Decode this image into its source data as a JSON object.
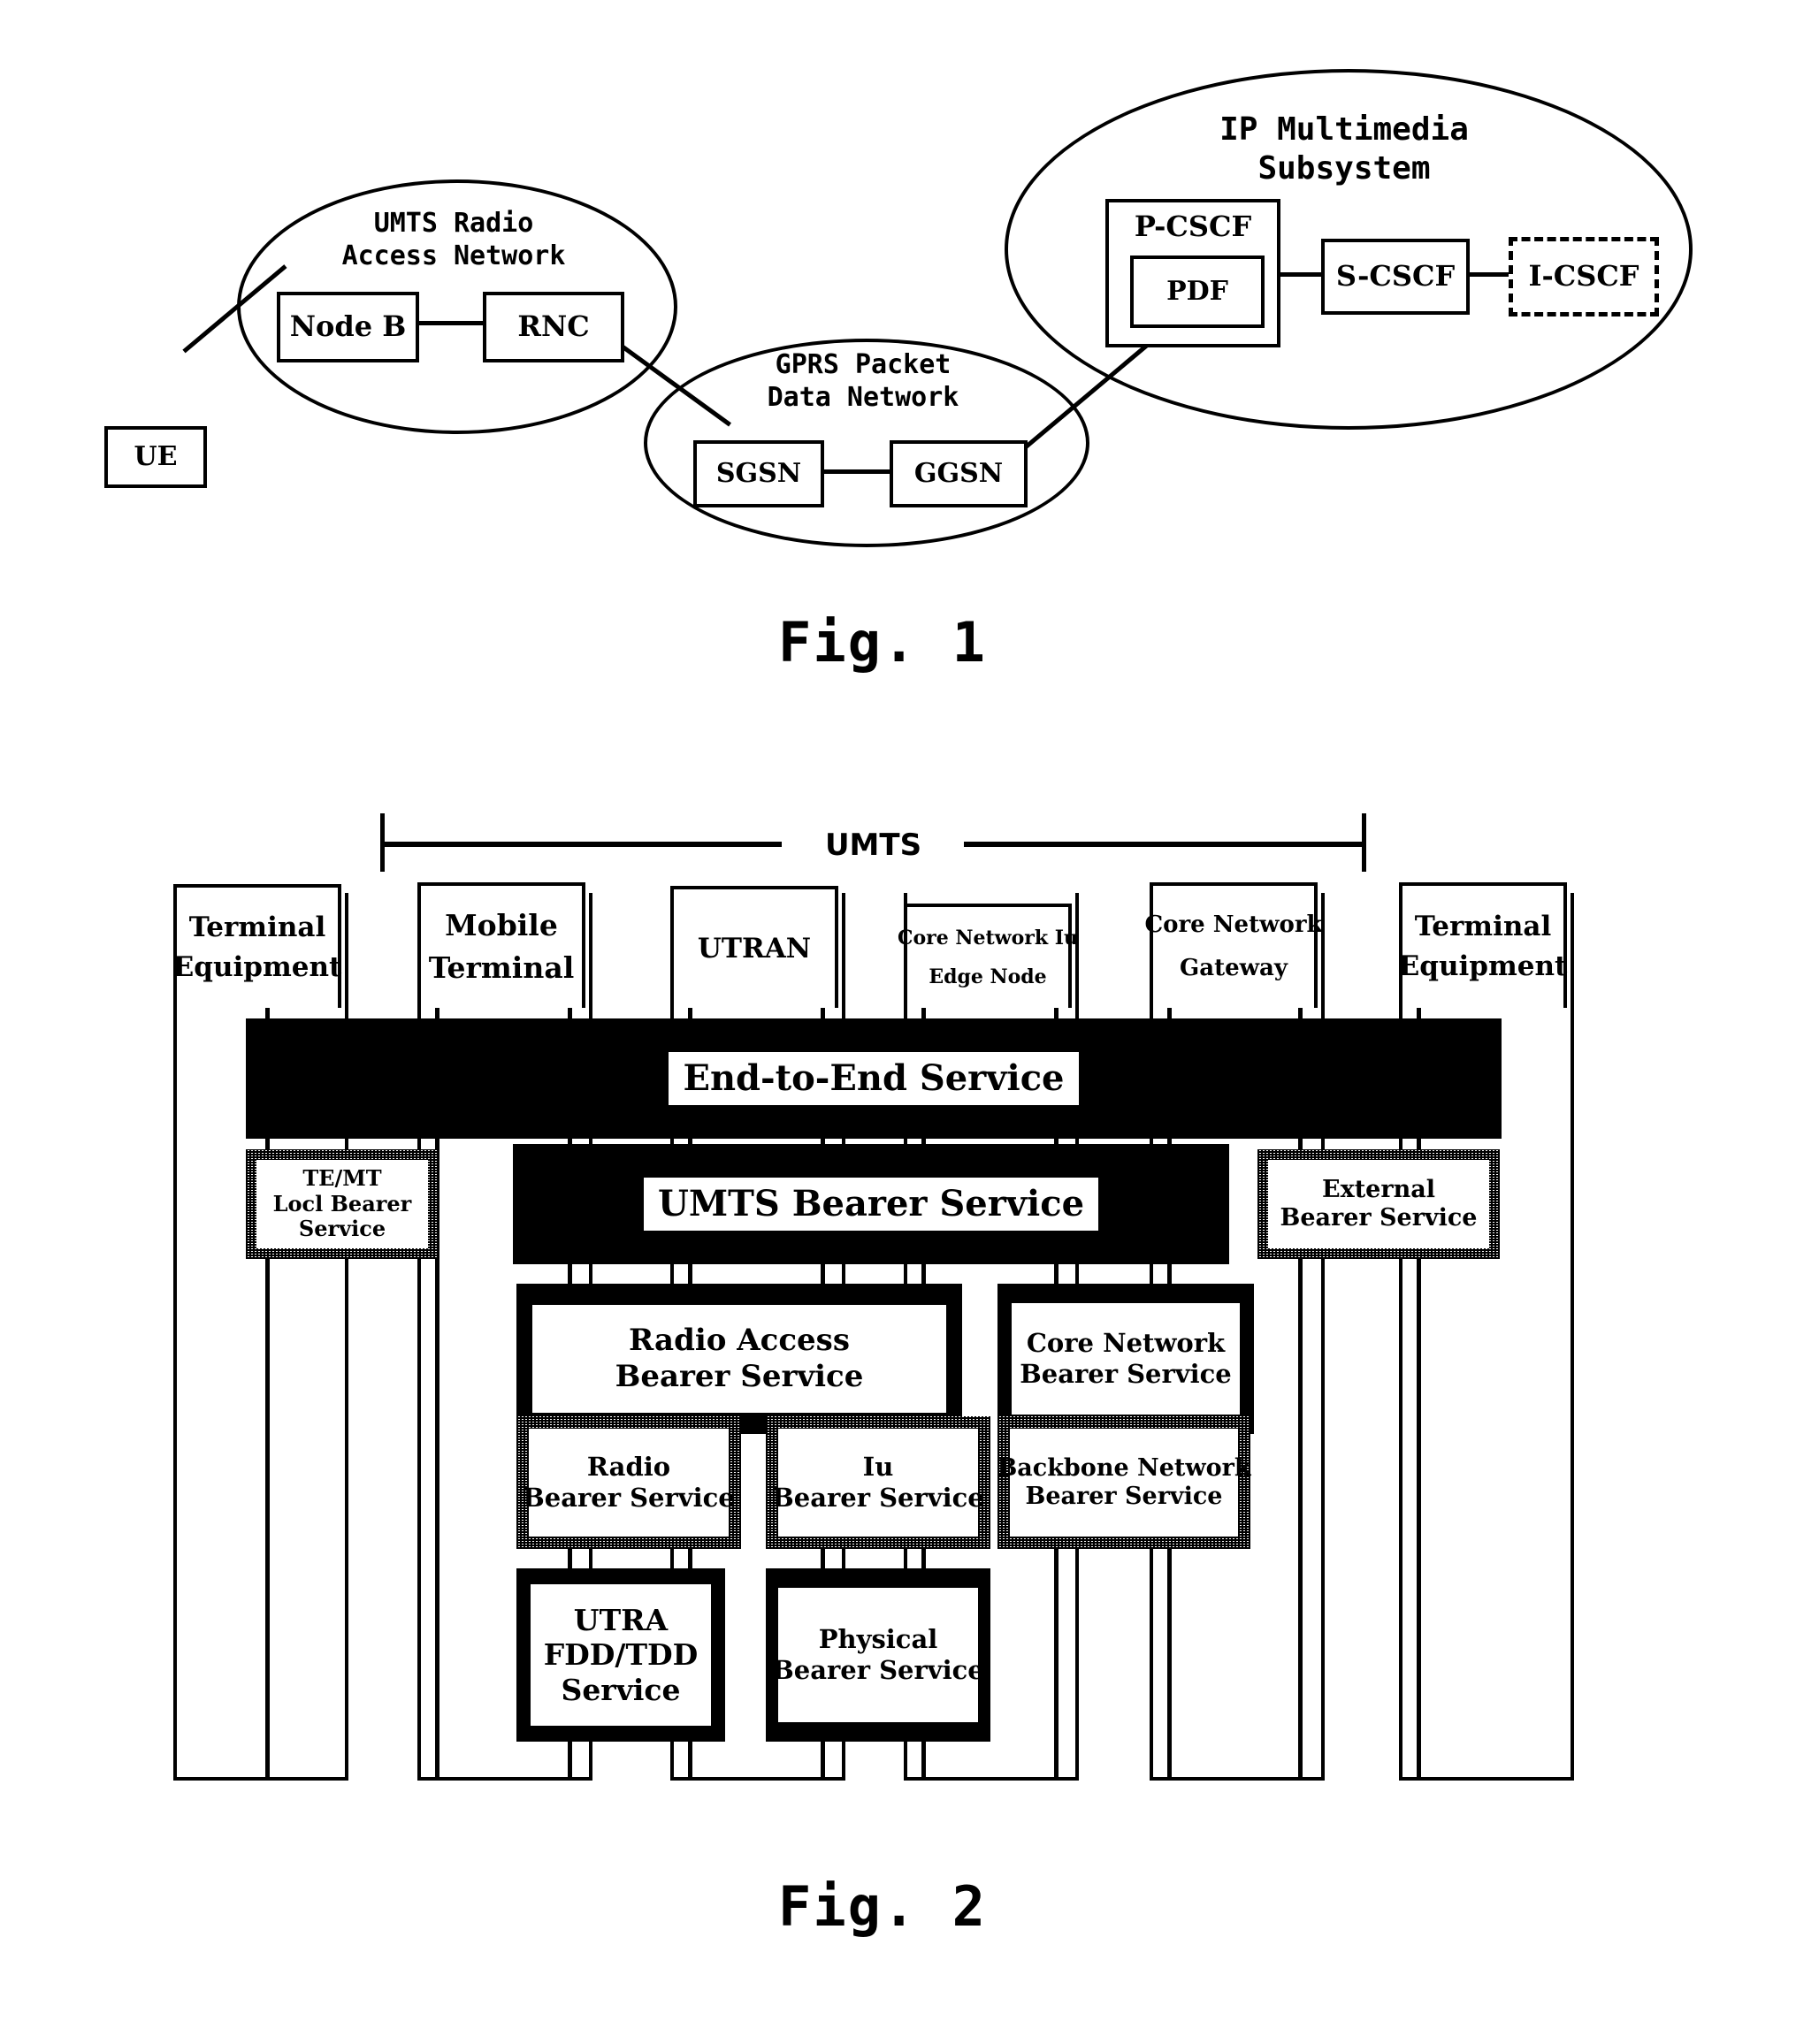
{
  "figure1": {
    "caption": "Fig. 1",
    "clouds": [
      {
        "id": "uran",
        "label": "UMTS Radio\nAccess Network"
      },
      {
        "id": "gprs",
        "label": "GPRS Packet\nData Network"
      },
      {
        "id": "ims",
        "label": "IP Multimedia\nSubsystem"
      }
    ],
    "nodes": {
      "ue": "UE",
      "nodeb": "Node B",
      "rnc": "RNC",
      "sgsn": "SGSN",
      "ggsn": "GGSN",
      "pcscf": "P-CSCF",
      "pdf": "PDF",
      "scscf": "S-CSCF",
      "icscf": "I-CSCF"
    }
  },
  "figure2": {
    "caption": "Fig. 2",
    "scope_label": "UMTS",
    "columns": [
      {
        "id": "te-left",
        "label": "Terminal\nEquipment"
      },
      {
        "id": "mt",
        "label": "Mobile\nTerminal"
      },
      {
        "id": "utran",
        "label": "UTRAN"
      },
      {
        "id": "cn-iu",
        "label": "Core Network Iu\nEdge Node"
      },
      {
        "id": "cn-gw",
        "label": "Core Network\nGateway"
      },
      {
        "id": "te-right",
        "label": "Terminal\nEquipment"
      }
    ],
    "layers": {
      "end_to_end": "End-to-End Service",
      "te_mt_local": "TE/MT\nLocl Bearer\nService",
      "umts_bearer": "UMTS Bearer Service",
      "external_bearer": "External\nBearer Service",
      "radio_access": "Radio Access\nBearer Service",
      "core_network": "Core Network\nBearer Service",
      "radio_bearer": "Radio\nBearer Service",
      "iu_bearer": "Iu\nBearer Service",
      "backbone": "Backbone Network\nBearer Service",
      "utra_fdd_tdd": "UTRA\nFDD/TDD\nService",
      "physical": "Physical\nBearer Service"
    }
  },
  "colors": {
    "ink": "#000000",
    "paper": "#ffffff"
  }
}
